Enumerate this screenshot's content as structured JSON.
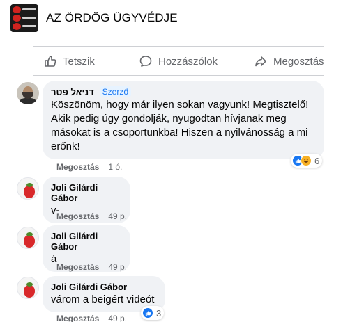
{
  "page": {
    "title": "AZ ÖRDÖG ÜGYVÉDJE"
  },
  "actions": {
    "like_label": "Tetszik",
    "comment_label": "Hozzászólok",
    "share_label": "Megosztás"
  },
  "comments": [
    {
      "author": "דניאל פטר",
      "badge": "Szerző",
      "text": "Köszönöm, hogy már ilyen sokan vagyunk! Megtisztelő! Akik pedig úgy gondolják, nyugodtan hívjanak meg másokat is a csoportunkba! Hiszen a nyilvánosság a mi erőnk!",
      "share": "Megosztás",
      "time": "1 ó.",
      "reactions": {
        "icons": [
          "like-icon",
          "haha-icon"
        ],
        "count": "6"
      }
    },
    {
      "author": "Joli Gilárdi Gábor",
      "text": "v-",
      "share": "Megosztás",
      "time": "49 p."
    },
    {
      "author": "Joli Gilárdi Gábor",
      "text": "á",
      "share": "Megosztás",
      "time": "49 p."
    },
    {
      "author": "Joli Gilárdi Gábor",
      "text": "várom a beigért videót",
      "share": "Megosztás",
      "time": "49 p.",
      "reactions": {
        "icons": [
          "like-icon"
        ],
        "count": "3"
      }
    }
  ],
  "colors": {
    "accent": "#1877f2",
    "secondary_text": "#65676b",
    "bubble": "#f0f2f5"
  }
}
